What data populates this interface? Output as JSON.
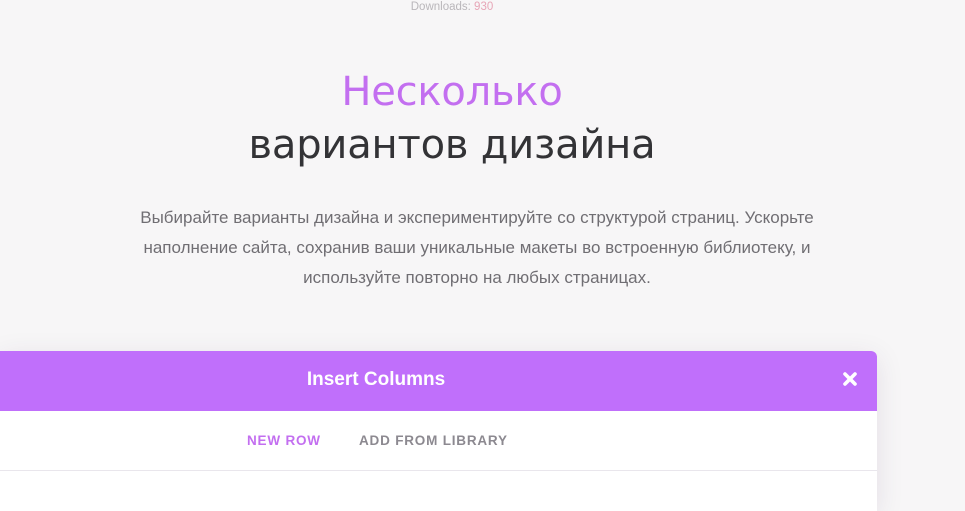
{
  "downloads": {
    "label": "Downloads:",
    "count": "930"
  },
  "hero": {
    "title_accent": "Несколько",
    "title_main": "вариантов дизайна",
    "description": "Выбирайте варианты дизайна и экспериментируйте со структурой страниц. Ускорьте наполнение сайта, сохранив ваши уникальные макеты во встроенную библиотеку, и используйте повторно на любых страницах."
  },
  "modal": {
    "title": "Insert Columns",
    "close_icon": "close-icon",
    "tabs": [
      {
        "label": "New Row",
        "active": true
      },
      {
        "label": "Add From Library",
        "active": false
      }
    ]
  },
  "colors": {
    "accent": "#c36ff0",
    "modal_header": "#c06ffb",
    "heading": "#333336",
    "body_text": "#706e73",
    "download_count": "#e7a6b7"
  }
}
